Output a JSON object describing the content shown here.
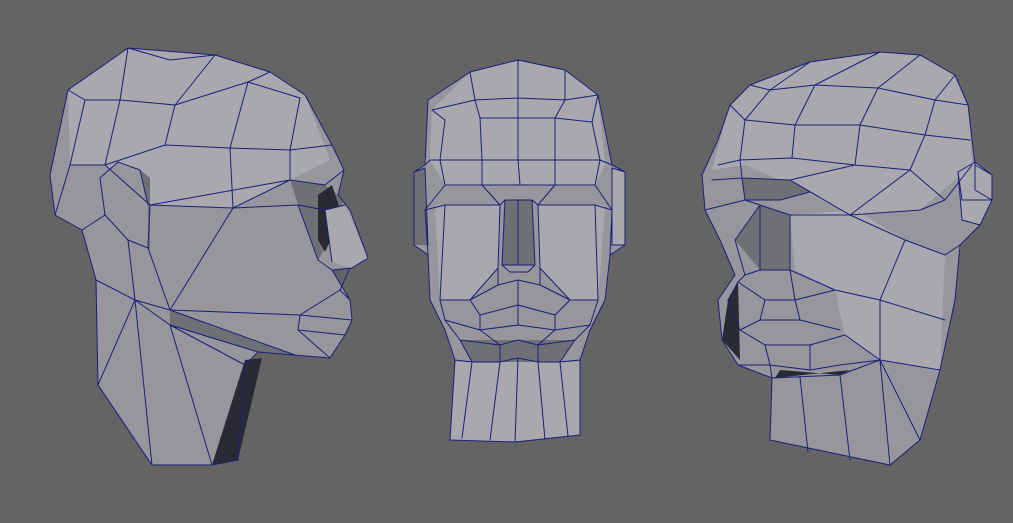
{
  "scene": {
    "background": "#646464",
    "wire_color": "#1c1f7a",
    "shades": {
      "light": "#a8a8ae",
      "mid": "#96969c",
      "shadow": "#6f6f76",
      "dark": "#2a2a34"
    },
    "views": [
      {
        "name": "side-profile-view"
      },
      {
        "name": "front-view"
      },
      {
        "name": "three-quarter-view"
      }
    ]
  }
}
